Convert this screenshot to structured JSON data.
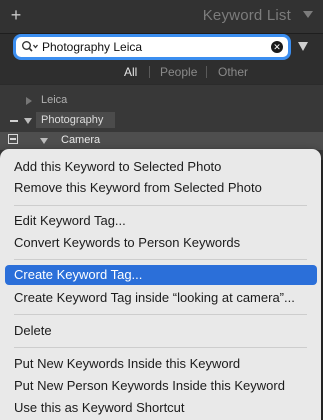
{
  "panel": {
    "title": "Keyword List",
    "add_icon": "plus-icon",
    "collapse_icon": "triangle-down-icon"
  },
  "search": {
    "value": "Photography Leica",
    "icon": "magnifier-dropdown-icon",
    "clear_icon": "clear-circle-icon",
    "focus_color": "#3b8ef0"
  },
  "filters": [
    {
      "label": "All",
      "active": true
    },
    {
      "label": "People",
      "active": false
    },
    {
      "label": "Other",
      "active": false
    }
  ],
  "keywords": [
    {
      "label": "Leica",
      "expanded": false
    },
    {
      "label": "Photography",
      "expanded": true
    },
    {
      "label": "Camera",
      "expanded": true
    }
  ],
  "context_menu": {
    "highlight_color": "#2b6fd9",
    "items": [
      {
        "label": "Add this Keyword to Selected Photo",
        "highlighted": false
      },
      {
        "label": "Remove this Keyword from Selected Photo",
        "highlighted": false
      },
      {
        "label": "Edit Keyword Tag...",
        "highlighted": false
      },
      {
        "label": "Convert Keywords to Person Keywords",
        "highlighted": false
      },
      {
        "label": "Create Keyword Tag...",
        "highlighted": true
      },
      {
        "label": "Create Keyword Tag inside “looking at camera”...",
        "highlighted": false
      },
      {
        "label": "Delete",
        "highlighted": false
      },
      {
        "label": "Put New Keywords Inside this Keyword",
        "highlighted": false
      },
      {
        "label": "Put New Person Keywords Inside this Keyword",
        "highlighted": false
      },
      {
        "label": "Use this as Keyword Shortcut",
        "highlighted": false
      }
    ]
  }
}
